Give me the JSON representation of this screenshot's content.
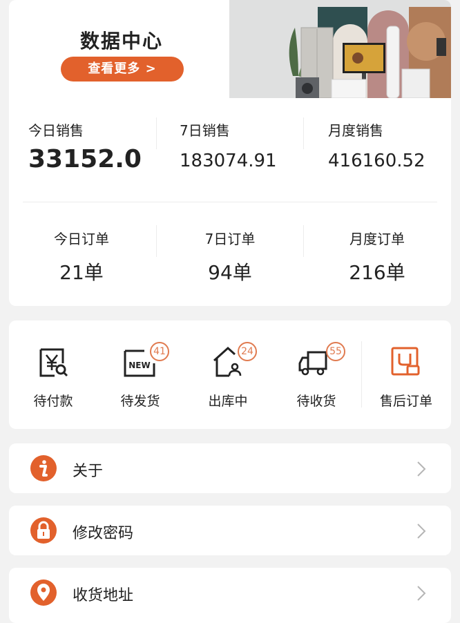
{
  "banner": {
    "title": "数据中心",
    "button_label": "查看更多 >"
  },
  "sales": {
    "today": {
      "label": "今日销售",
      "value": "33152.0"
    },
    "week": {
      "label": "7日销售",
      "value": "183074.91"
    },
    "month": {
      "label": "月度销售",
      "value": "416160.52"
    }
  },
  "orders_summary": {
    "today": {
      "label": "今日订单",
      "value": "21单"
    },
    "week": {
      "label": "7日订单",
      "value": "94单"
    },
    "month": {
      "label": "月度订单",
      "value": "216单"
    }
  },
  "order_status": [
    {
      "label": "待付款",
      "icon": "yen-search-icon",
      "badge": ""
    },
    {
      "label": "待发货",
      "icon": "new-box-icon",
      "badge": "41"
    },
    {
      "label": "出库中",
      "icon": "warehouse-person-icon",
      "badge": "24"
    },
    {
      "label": "待收货",
      "icon": "delivery-truck-icon",
      "badge": "55"
    },
    {
      "label": "售后订单",
      "icon": "after-sales-icon",
      "badge": ""
    }
  ],
  "menu": [
    {
      "label": "关于",
      "icon": "info-icon"
    },
    {
      "label": "修改密码",
      "icon": "lock-icon"
    },
    {
      "label": "收货地址",
      "icon": "location-pin-icon"
    }
  ],
  "colors": {
    "accent": "#e2612c",
    "badge": "#e07a4f",
    "background": "#f2f2f2",
    "card": "#ffffff"
  }
}
